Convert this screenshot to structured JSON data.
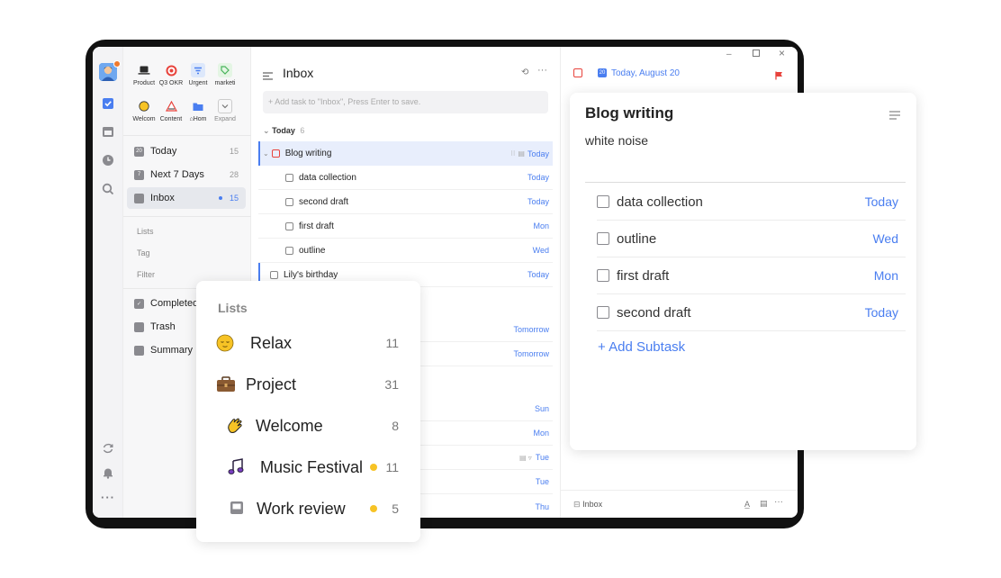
{
  "rail": {
    "icons": [
      "avatar",
      "checkbox-icon",
      "calendar-icon",
      "clock-icon",
      "search-icon",
      "sync-icon",
      "bell-icon",
      "more-icon"
    ]
  },
  "pinned": [
    {
      "label": "Product",
      "icon": "laptop-icon"
    },
    {
      "label": "Q3 OKR",
      "icon": "target-icon"
    },
    {
      "label": "Urgent",
      "icon": "filter-icon"
    },
    {
      "label": "marketi",
      "icon": "tag-icon"
    },
    {
      "label": "Welcom",
      "icon": "wave-hand-icon"
    },
    {
      "label": "Content",
      "icon": "pen-icon"
    },
    {
      "label": "Hom",
      "icon": "folder-icon"
    },
    {
      "label": "Expand",
      "icon": "chevron-down-icon"
    }
  ],
  "nav": [
    {
      "label": "Today",
      "count": "15",
      "icon": "20"
    },
    {
      "label": "Next 7 Days",
      "count": "28",
      "icon": "7"
    },
    {
      "label": "Inbox",
      "count": "15",
      "icon": ""
    }
  ],
  "sections": {
    "lists": "Lists",
    "tag": "Tag",
    "filter": "Filter"
  },
  "bottom_nav": [
    {
      "label": "Completed"
    },
    {
      "label": "Trash"
    },
    {
      "label": "Summary"
    }
  ],
  "list": {
    "title": "Inbox",
    "add_placeholder": "+ Add task to \"Inbox\", Press Enter to save.",
    "group_today": "Today",
    "group_today_count": "6",
    "task_main": {
      "title": "Blog writing",
      "due": "Today"
    },
    "subtasks": [
      {
        "title": "data collection",
        "due": "Today"
      },
      {
        "title": "second draft",
        "due": "Today"
      },
      {
        "title": "first draft",
        "due": "Mon"
      },
      {
        "title": "outline",
        "due": "Wed"
      }
    ],
    "task_birthday": {
      "title": "Lily's birthday",
      "due": "Today"
    },
    "more_dues": [
      "Tomorrow",
      "Tomorrow",
      "Sun",
      "Mon",
      "Tue",
      "Tue",
      "Thu"
    ]
  },
  "detail": {
    "date": "Today, August 20",
    "footer_list": "Inbox"
  },
  "lists_card": {
    "heading": "Lists",
    "items": [
      {
        "label": "Relax",
        "count": "11",
        "dot": false
      },
      {
        "label": "Project",
        "count": "31",
        "dot": false
      },
      {
        "label": "Welcome",
        "count": "8",
        "dot": false
      },
      {
        "label": "Music Festival",
        "count": "11",
        "dot": true
      },
      {
        "label": "Work review",
        "count": "5",
        "dot": true
      }
    ]
  },
  "detail_card": {
    "title": "Blog writing",
    "note": "white noise",
    "subtasks": [
      {
        "title": "data collection",
        "due": "Today"
      },
      {
        "title": "outline",
        "due": "Wed"
      },
      {
        "title": "first draft",
        "due": "Mon"
      },
      {
        "title": "second draft",
        "due": "Today"
      }
    ],
    "add_subtask": "+ Add Subtask"
  },
  "colors": {
    "accent": "#4a7ef0",
    "flag": "#e8433c",
    "dot": "#f7c325"
  }
}
